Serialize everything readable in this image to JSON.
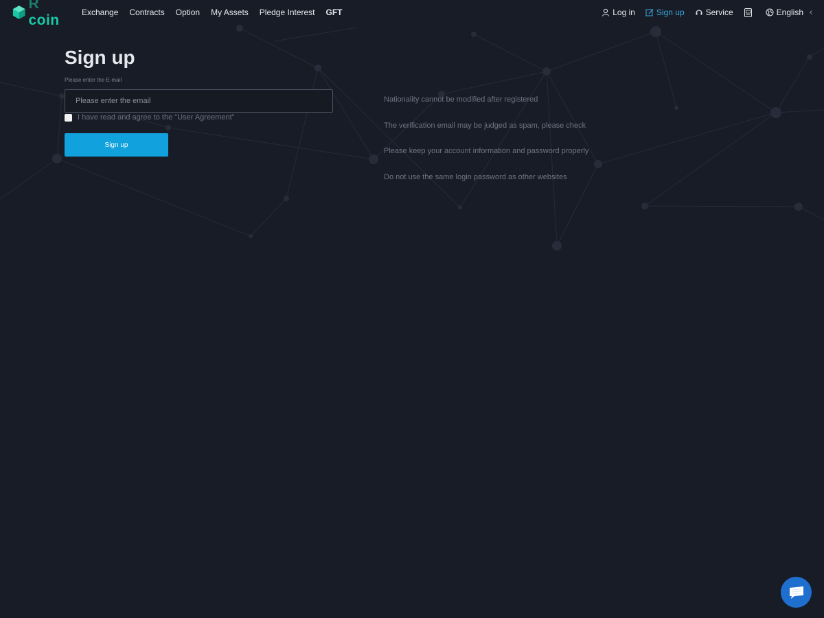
{
  "header": {
    "logo": {
      "letter": "R",
      "name": "coin",
      "icon": "rcoin-logo-icon"
    },
    "nav": [
      "Exchange",
      "Contracts",
      "Option",
      "My Assets",
      "Pledge Interest",
      "GFT"
    ],
    "right": {
      "login": "Log in",
      "signup": "Sign up",
      "service": "Service",
      "language": "English"
    }
  },
  "form": {
    "title": "Sign up",
    "email_label": "Please enter the E-mail",
    "email_placeholder": "Please enter the email",
    "email_value": "",
    "agreement": "I have read and agree to the \"User Agreement\"",
    "agreement_checked": false,
    "submit": "Sign up"
  },
  "tips": [
    "Nationality cannot be modified after registered",
    "The verification email may be judged as spam, please check",
    "Please keep your account information and password properly",
    "Do not use the same login password as other websites"
  ],
  "colors": {
    "background": "#181c26",
    "accent": "#11a1dc",
    "brand": "#19c9a6",
    "active_link": "#3aa9e0",
    "chat": "#1f6fcf"
  },
  "icons": {
    "login": "user-icon",
    "signup": "edit-icon",
    "service": "headset-icon",
    "app": "app-download-icon",
    "language": "globe-icon",
    "language_toggle": "chevron-left-icon",
    "chat": "chat-bubble-icon"
  }
}
